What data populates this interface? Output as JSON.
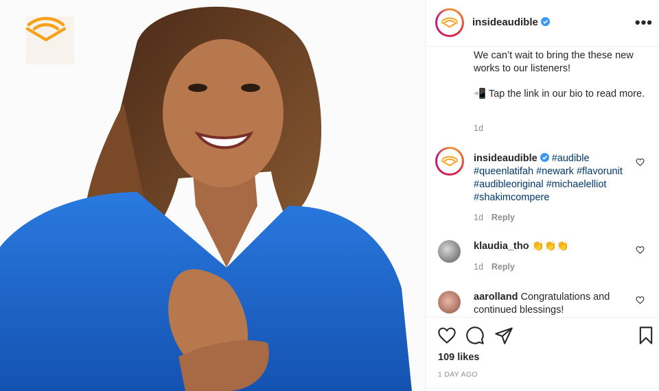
{
  "post": {
    "username": "insideaudible",
    "caption": {
      "line1": "We can’t wait to bring the these new works to our listeners!",
      "line2": "📲 Tap the link in our bio to read more."
    },
    "caption_time": "1d"
  },
  "comments": [
    {
      "username": "insideaudible",
      "text": "#audible #queenlatifah #newark #flavorunit #audibleoriginal #michaelelliot #shakimcompere",
      "time": "1d",
      "reply": "Reply"
    },
    {
      "username": "klaudia_tho",
      "text": "👏👏👏",
      "time": "1d",
      "reply": "Reply"
    },
    {
      "username": "aarolland",
      "text": "Congratulations and continued blessings!"
    }
  ],
  "likes": "109 likes",
  "post_date": "1 DAY AGO",
  "icons": {
    "more": "more-options-icon",
    "like": "heart-icon",
    "comment": "comment-icon",
    "share": "share-icon",
    "save": "bookmark-icon",
    "verified": "verified-badge-icon"
  },
  "colors": {
    "accent": "#f7a11a",
    "hashtag": "#00376b",
    "verified": "#3897f0",
    "shirt": "#1a64c8"
  }
}
